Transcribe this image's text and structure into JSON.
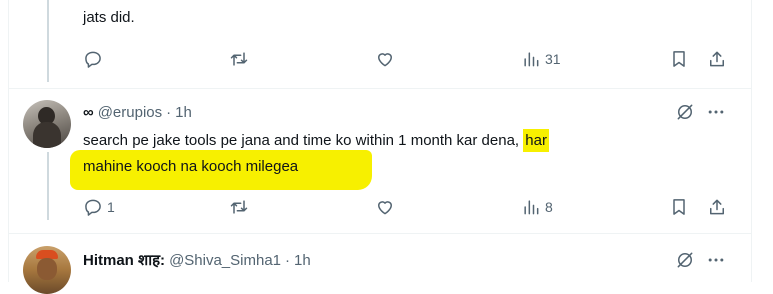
{
  "tweet_prev": {
    "text_tail": "jats did.",
    "actions": {
      "views": "31"
    }
  },
  "reply_1": {
    "infinity": "∞",
    "handle": "@erupios",
    "dot": "·",
    "time": "1h",
    "text_plain": "search pe jake tools pe jana and time ko within 1 month kar dena, ",
    "text_hl_1": "har",
    "text_hl_2": "mahine kooch na kooch milegea",
    "actions": {
      "replies": "1",
      "views": "8"
    }
  },
  "reply_2": {
    "name": "Hitman शाह:",
    "handle": "@Shiva_Simha1",
    "dot": "·",
    "time": "1h"
  },
  "icons": {
    "reply": "reply-icon",
    "retweet": "retweet-icon",
    "like": "heart-icon",
    "views": "analytics-icon",
    "bookmark": "bookmark-icon",
    "share": "share-icon",
    "grok": "grok-icon",
    "more": "more-icon"
  },
  "colors": {
    "text": "#0f1419",
    "secondary": "#536471",
    "highlight": "#f7f000",
    "thread_line": "#cfd9de"
  }
}
